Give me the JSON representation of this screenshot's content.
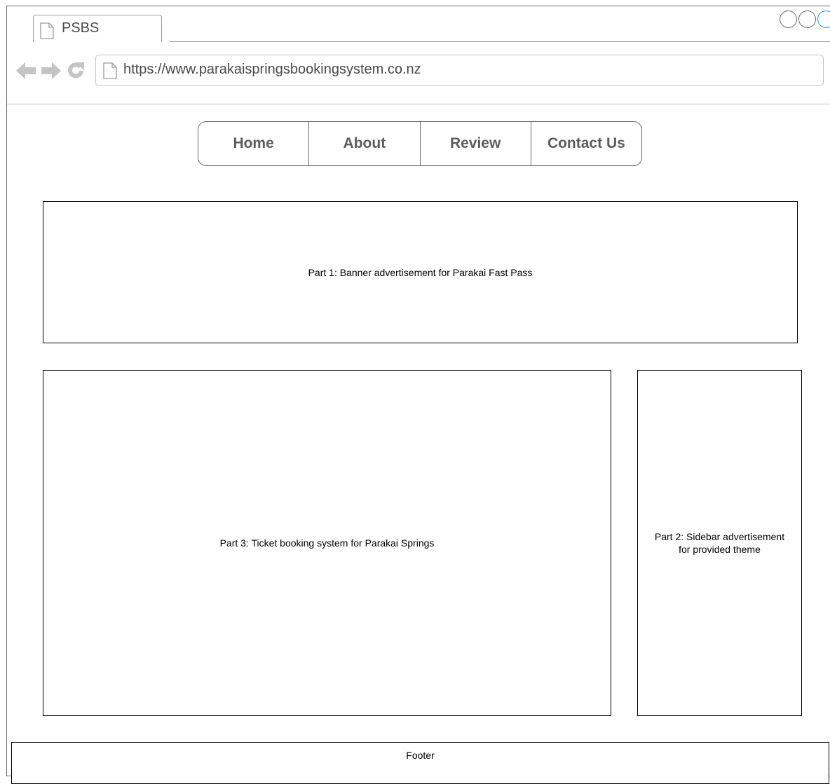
{
  "browser": {
    "tab_title": "PSBS",
    "url": "https://www.parakaispringsbookingsystem.co.nz",
    "accent_color": "#2a8fe0"
  },
  "nav": {
    "items": [
      {
        "label": "Home"
      },
      {
        "label": "About"
      },
      {
        "label": "Review"
      },
      {
        "label": "Contact Us"
      }
    ]
  },
  "content": {
    "banner_text": "Part 1: Banner advertisement for Parakai Fast Pass",
    "booking_text": "Part 3: Ticket booking system for Parakai Springs",
    "sidebar_text": "Part 2: Sidebar advertisement for provided theme",
    "footer_text": "Footer"
  }
}
